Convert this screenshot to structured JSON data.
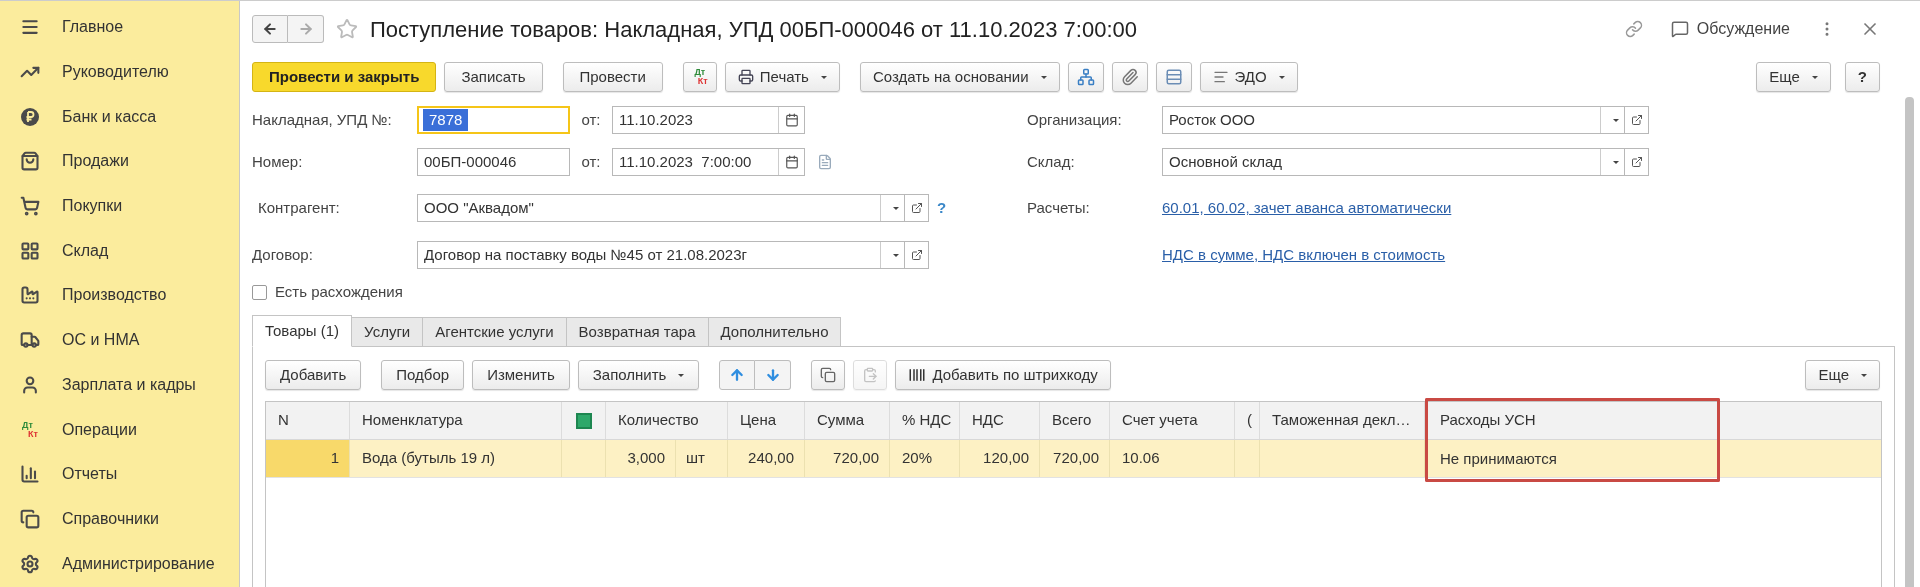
{
  "sidebar": {
    "items": [
      {
        "label": "Главное",
        "selected": false
      },
      {
        "label": "Руководителю",
        "selected": false
      },
      {
        "label": "Банк и касса",
        "selected": false
      },
      {
        "label": "Продажи",
        "selected": false
      },
      {
        "label": "Покупки",
        "selected": false
      },
      {
        "label": "Склад",
        "selected": false
      },
      {
        "label": "Производство",
        "selected": false
      },
      {
        "label": "ОС и НМА",
        "selected": false
      },
      {
        "label": "Зарплата и кадры",
        "selected": false
      },
      {
        "label": "Операции",
        "selected": false,
        "icon_text": [
          "Дт",
          "Кт"
        ]
      },
      {
        "label": "Отчеты",
        "selected": false
      },
      {
        "label": "Справочники",
        "selected": false
      },
      {
        "label": "Администрирование",
        "selected": false
      }
    ]
  },
  "window": {
    "title": "Поступление товаров: Накладная, УПД 00БП-000046 от 11.10.2023 7:00:00",
    "discussion": "Обсуждение"
  },
  "toolbar": {
    "post_close": "Провести и закрыть",
    "save": "Записать",
    "post": "Провести",
    "dt_kt": [
      "Дт",
      "Кт"
    ],
    "print": "Печать",
    "create_based": "Создать на основании",
    "edo": "ЭДО",
    "more": "Еще",
    "help": "?"
  },
  "form": {
    "invoice": {
      "label": "Накладная, УПД №:",
      "value": "7878",
      "date_label": "от:",
      "date": "11.10.2023"
    },
    "number": {
      "label": "Номер:",
      "value": "00БП-000046",
      "date_label": "от:",
      "date": "11.10.2023  7:00:00"
    },
    "counterparty": {
      "label": "Контрагент:",
      "value": "ООО \"Аквадом\"",
      "help": "?"
    },
    "contract": {
      "label": "Договор:",
      "value": "Договор на поставку воды №45 от 21.08.2023г"
    },
    "discrepancies": {
      "label": "Есть расхождения",
      "checked": false
    },
    "organization": {
      "label": "Организация:",
      "value": "Росток ООО"
    },
    "warehouse": {
      "label": "Склад:",
      "value": "Основной склад"
    },
    "settlements": {
      "label": "Расчеты:",
      "link": "60.01, 60.02, зачет аванса автоматически"
    },
    "vat_link": "НДС в сумме, НДС включен в стоимость"
  },
  "tabs": [
    {
      "label": "Товары (1)",
      "selected": true
    },
    {
      "label": "Услуги",
      "selected": false
    },
    {
      "label": "Агентские услуги",
      "selected": false
    },
    {
      "label": "Возвратная тара",
      "selected": false
    },
    {
      "label": "Дополнительно",
      "selected": false
    }
  ],
  "table_toolbar": {
    "add": "Добавить",
    "pick": "Подбор",
    "edit": "Изменить",
    "fill": "Заполнить",
    "barcode": "Добавить по штрихкоду",
    "more": "Еще"
  },
  "table": {
    "columns": [
      {
        "kind": "text",
        "label": "N",
        "highlighted": false
      },
      {
        "kind": "text",
        "label": "Номенклатура",
        "highlighted": false
      },
      {
        "kind": "icon",
        "highlighted": false
      },
      {
        "kind": "text",
        "label": "Количество",
        "highlighted": false
      },
      {
        "kind": "text",
        "label": "Цена",
        "highlighted": false
      },
      {
        "kind": "text",
        "label": "Сумма",
        "highlighted": false
      },
      {
        "kind": "text",
        "label": "% НДС",
        "highlighted": false
      },
      {
        "kind": "text",
        "label": "НДС",
        "highlighted": false
      },
      {
        "kind": "text",
        "label": "Всего",
        "highlighted": false
      },
      {
        "kind": "text",
        "label": "Счет учета",
        "highlighted": false
      },
      {
        "kind": "text",
        "label": "(",
        "highlighted": false
      },
      {
        "kind": "text",
        "label": "Таможенная декл…",
        "highlighted": false
      },
      {
        "kind": "text",
        "label": "Расходы УСН",
        "highlighted": true
      }
    ],
    "rows": [
      {
        "selected": true,
        "cells": [
          {
            "text": "1"
          },
          {
            "text": "Вода (бутыль 19 л)"
          },
          null,
          {
            "text": "3,000",
            "unit": "шт"
          },
          {
            "text": "240,00"
          },
          {
            "text": "720,00"
          },
          {
            "text": "20%"
          },
          {
            "text": "120,00"
          },
          {
            "text": "720,00"
          },
          {
            "text": "10.06"
          },
          null,
          null,
          {
            "text": "Не принимаются"
          }
        ]
      }
    ]
  }
}
